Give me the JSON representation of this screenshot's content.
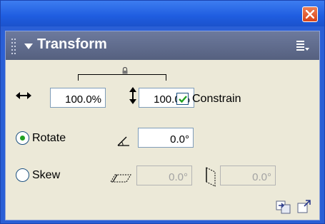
{
  "panel": {
    "title": "Transform"
  },
  "scale": {
    "width_value": "100.0%",
    "height_value": "100.0%",
    "constrain_label": "Constrain",
    "constrain_checked": true
  },
  "rotate": {
    "label": "Rotate",
    "selected": true,
    "value": "0.0°"
  },
  "skew": {
    "label": "Skew",
    "selected": false,
    "horizontal_value": "0.0°",
    "vertical_value": "0.0°"
  },
  "icons": {
    "close": "close-icon",
    "options": "panel-options-icon",
    "copy_and_apply": "copy-and-apply-transform-icon",
    "reset": "reset-transform-icon"
  },
  "colors": {
    "title_bar": "#2a5fd6",
    "panel_header": "#5f6b8c",
    "panel_body": "#ece9d8",
    "check_accent": "#21a121"
  }
}
